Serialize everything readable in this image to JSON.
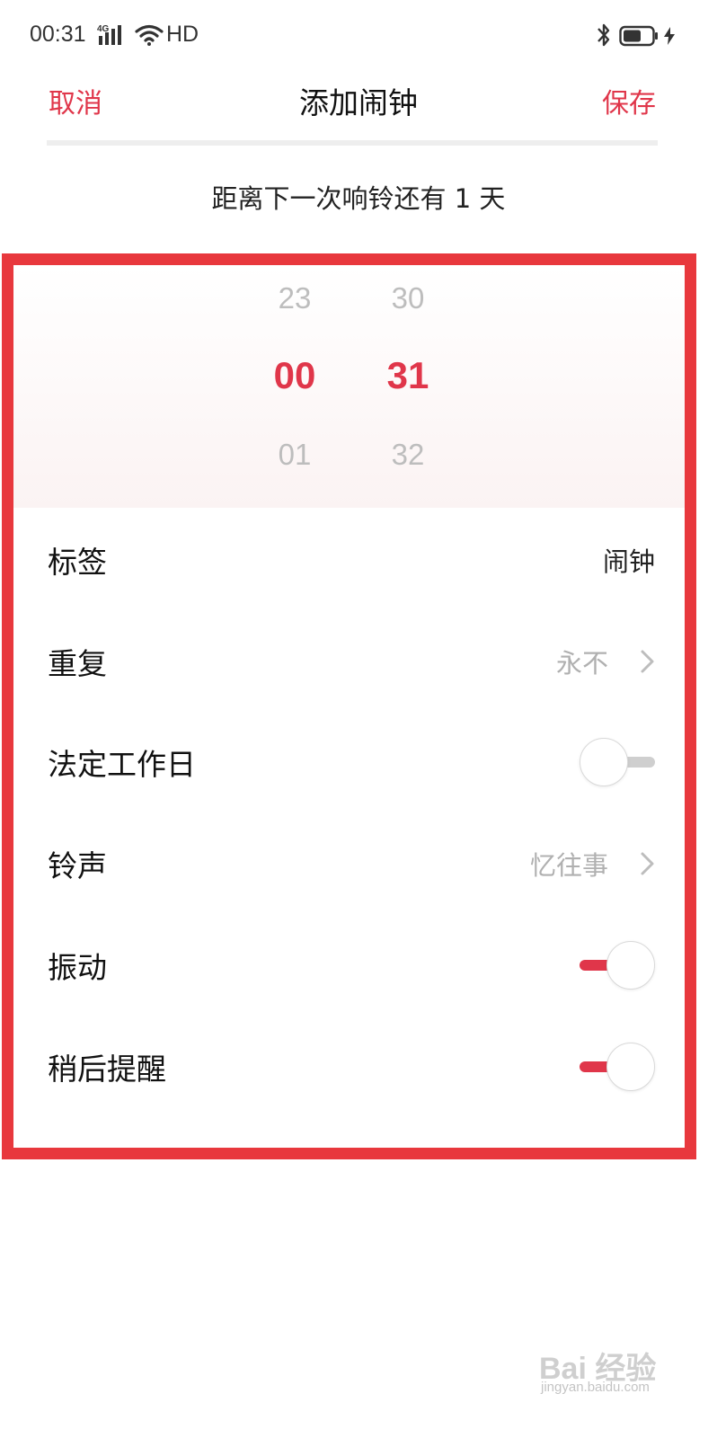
{
  "status_bar": {
    "time": "00:31",
    "network": "4G",
    "hd": "HD"
  },
  "header": {
    "cancel_label": "取消",
    "title": "添加闹钟",
    "save_label": "保存"
  },
  "countdown_text": "距离下一次响铃还有  1 天",
  "time_picker": {
    "hours": {
      "prev": "23",
      "selected": "00",
      "next": "01"
    },
    "minutes": {
      "prev": "30",
      "selected": "31",
      "next": "32"
    }
  },
  "settings": {
    "label_row": {
      "label": "标签",
      "value": "闹钟"
    },
    "repeat_row": {
      "label": "重复",
      "value": "永不"
    },
    "workday_row": {
      "label": "法定工作日",
      "enabled": false
    },
    "ringtone_row": {
      "label": "铃声",
      "value": "忆往事"
    },
    "vibrate_row": {
      "label": "振动",
      "enabled": true
    },
    "snooze_row": {
      "label": "稍后提醒",
      "enabled": true
    }
  },
  "watermark": {
    "main": "Bai 经验",
    "sub": "jingyan.baidu.com"
  },
  "colors": {
    "accent": "#e0364a",
    "annotation_frame": "#e8383d",
    "muted_text": "#b0b0b0"
  },
  "icons": [
    "signal-icon",
    "wifi-icon",
    "bluetooth-icon",
    "battery-icon",
    "charging-icon",
    "chevron-right-icon"
  ]
}
